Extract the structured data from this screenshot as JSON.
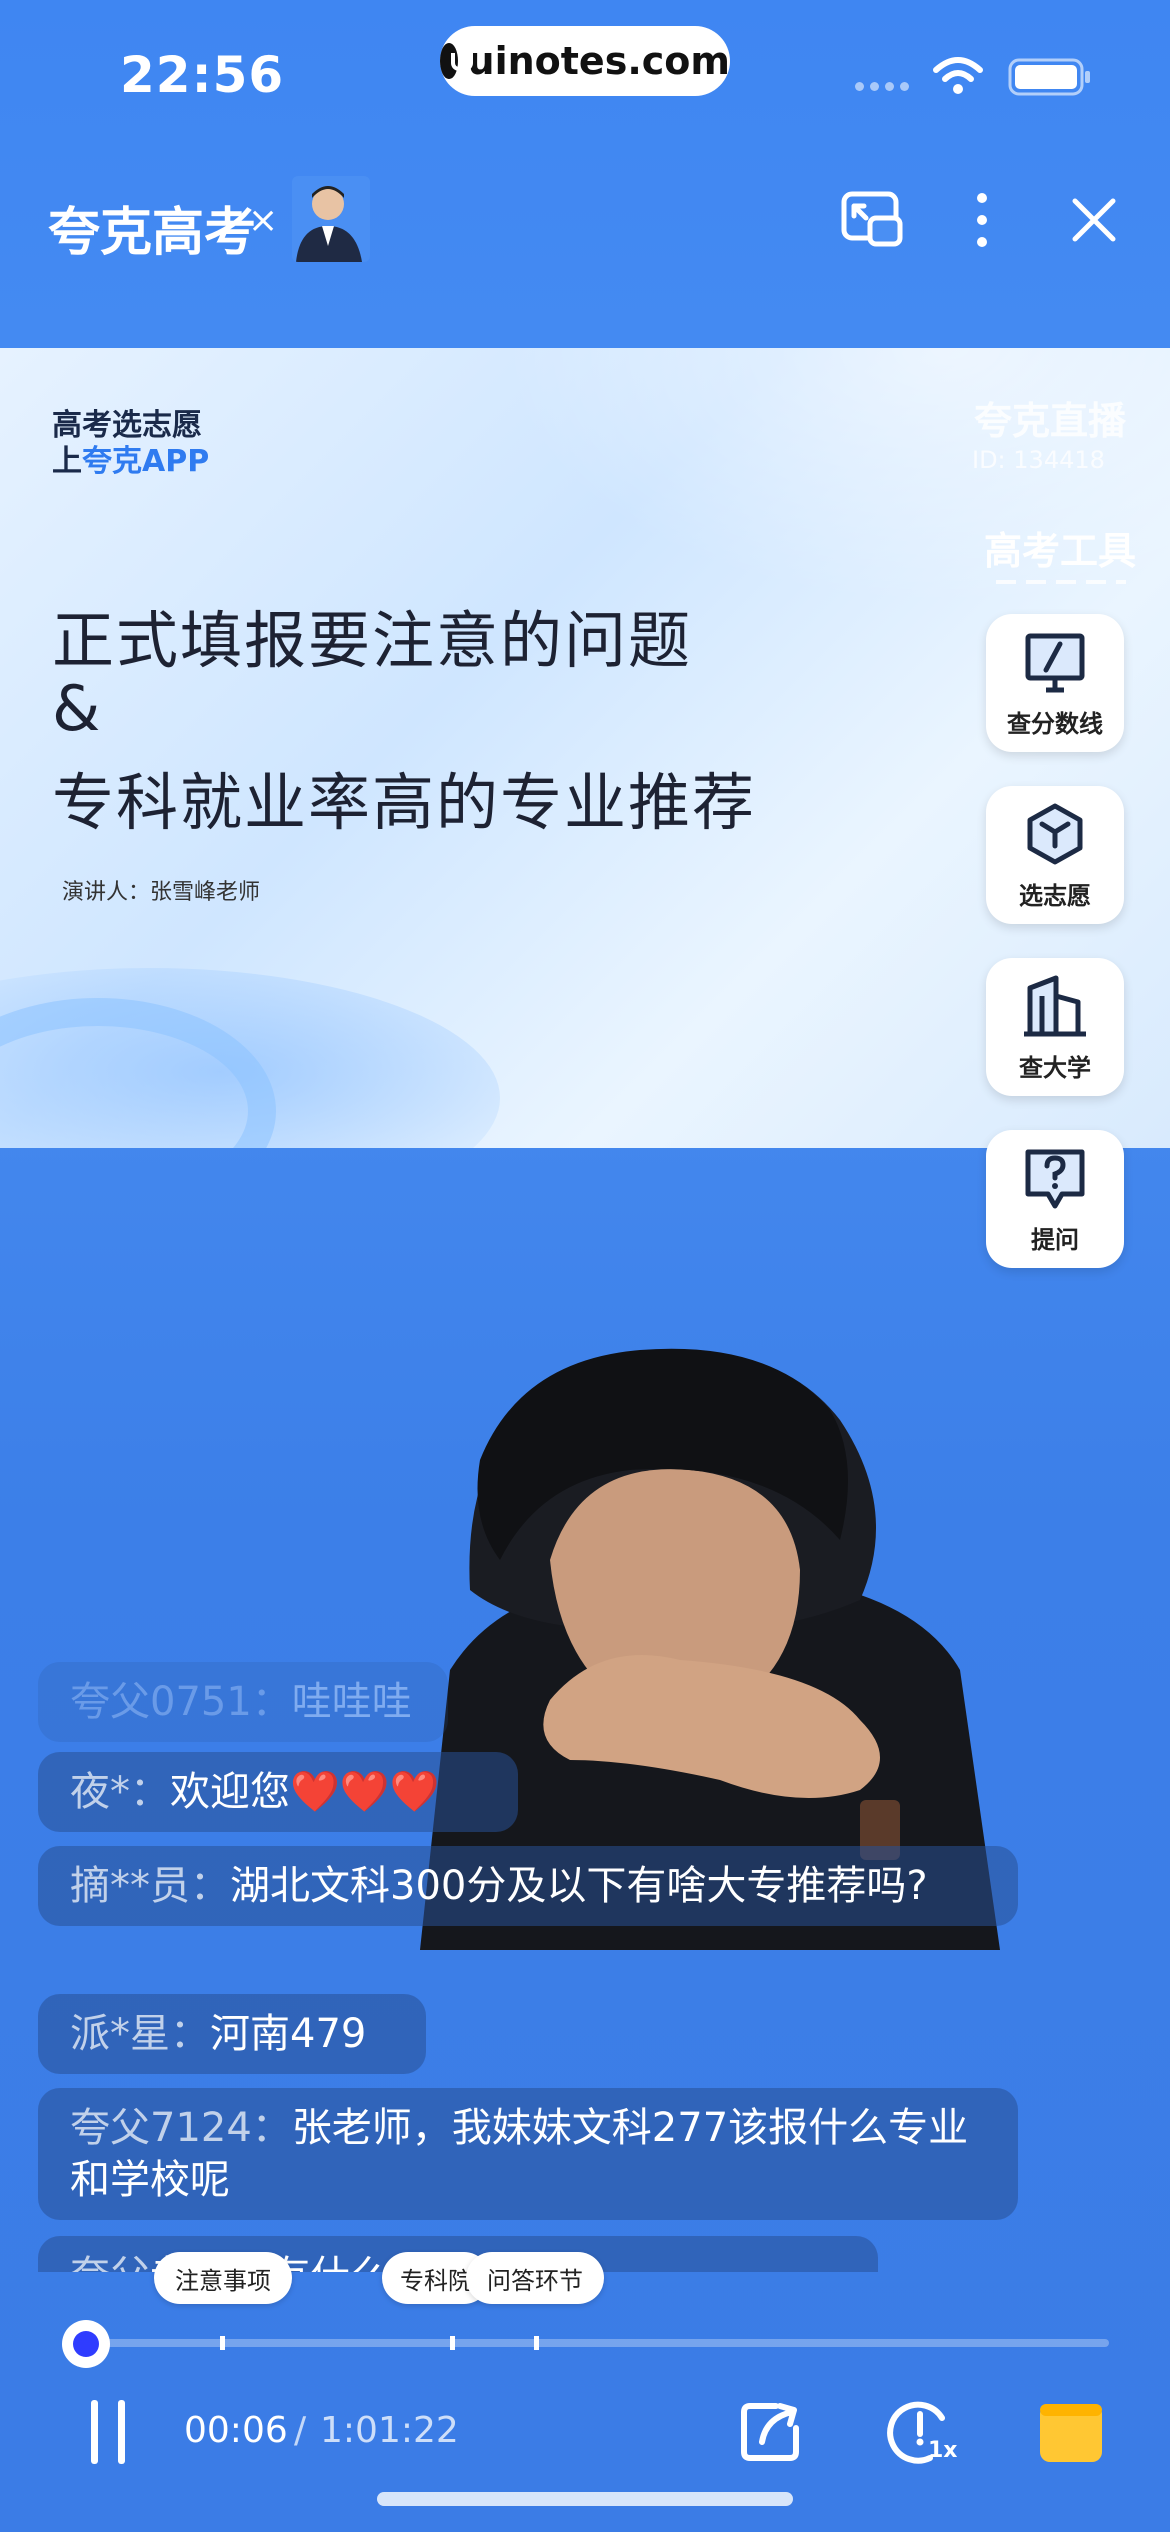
{
  "status_bar": {
    "time": "22:56",
    "url": "uinotes.com"
  },
  "header": {
    "title": "夸克高考",
    "close_x": "×"
  },
  "slide": {
    "tag_line1": "高考选志愿",
    "tag_line2_prefix": "上",
    "tag_line2_brand": "夸克APP",
    "title_lines": [
      "正式填报要注意的问题",
      "&",
      "专科就业率高的专业推荐"
    ],
    "speaker": "演讲人：张雪峰老师",
    "live_brand": "夸克直播",
    "live_id": "ID: 134418"
  },
  "tools": {
    "title": "高考工具",
    "items": [
      {
        "label": "查分数线",
        "icon": "score-line-icon"
      },
      {
        "label": "选志愿",
        "icon": "choose-major-icon"
      },
      {
        "label": "查大学",
        "icon": "university-icon"
      },
      {
        "label": "提问",
        "icon": "question-icon"
      }
    ]
  },
  "chat": [
    {
      "user": "夸父0751：",
      "text": "哇哇哇"
    },
    {
      "user": "夜*：",
      "text": "欢迎您❤️❤️❤️"
    },
    {
      "user": "摘**员：",
      "text": "湖北文科300分及以下有啥大专推荐吗?"
    },
    {
      "user": "派*星：",
      "text": "河南479"
    },
    {
      "user": "夸父7124：",
      "text": "张老师，我妹妹文科277该报什么专业和学校呢"
    },
    {
      "user": "夸父",
      "text": "老师，有什么好推荐"
    }
  ],
  "chapters": [
    "注意事项",
    "专科院",
    "问答环节"
  ],
  "player": {
    "current": "00:06",
    "separator": "/",
    "total": "1:01:22",
    "progress": 0.0017,
    "speed": "1x"
  }
}
